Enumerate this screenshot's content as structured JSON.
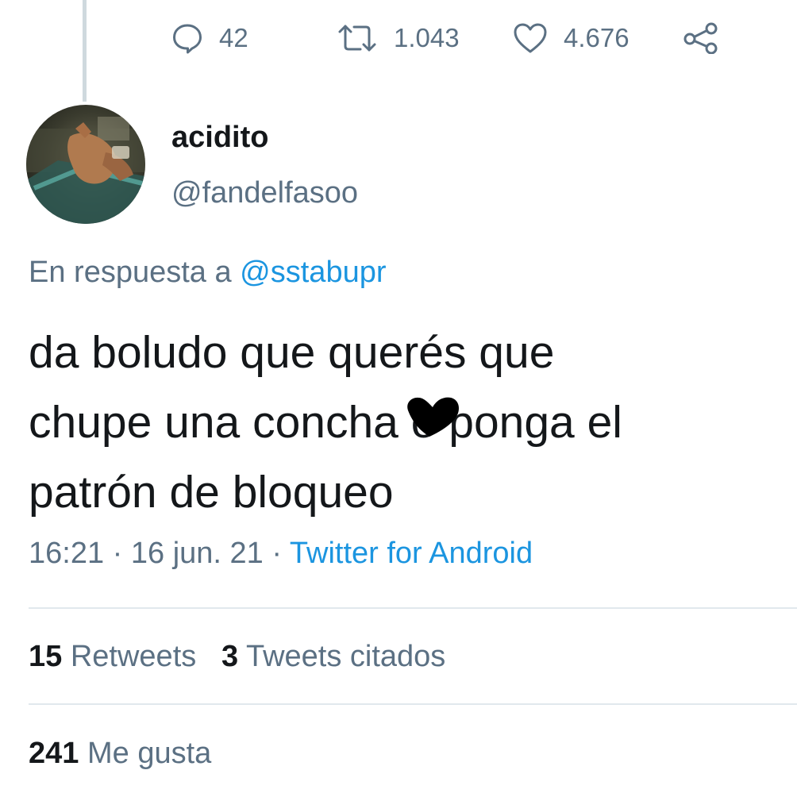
{
  "actions": {
    "replies": {
      "icon": "reply-icon",
      "count": "42"
    },
    "retweets": {
      "icon": "retweet-icon",
      "count": "1.043"
    },
    "likes": {
      "icon": "heart-icon",
      "count": "4.676"
    },
    "share": {
      "icon": "share-icon"
    }
  },
  "author": {
    "display_name": "acidito",
    "handle": "@fandelfasoo"
  },
  "reply_to": {
    "prefix": "En respuesta a",
    "mention": "@sstabupr"
  },
  "tweet": {
    "lines": [
      "da boludo que querés que",
      "chupe una concha o ponga el",
      "patrón de bloqueo"
    ]
  },
  "meta": {
    "time": "16:21",
    "separator": "·",
    "date": "16 jun. 21",
    "source": "Twitter for Android"
  },
  "stats": {
    "retweets_count": "15",
    "retweets_label": "Retweets",
    "quotes_count": "3",
    "quotes_label": "Tweets citados",
    "likes_count": "241",
    "likes_label": "Me gusta"
  },
  "colors": {
    "link": "#1b95e0",
    "secondary_text": "#5b7083",
    "primary_text": "#14171a",
    "divider": "#e1e8ed"
  }
}
